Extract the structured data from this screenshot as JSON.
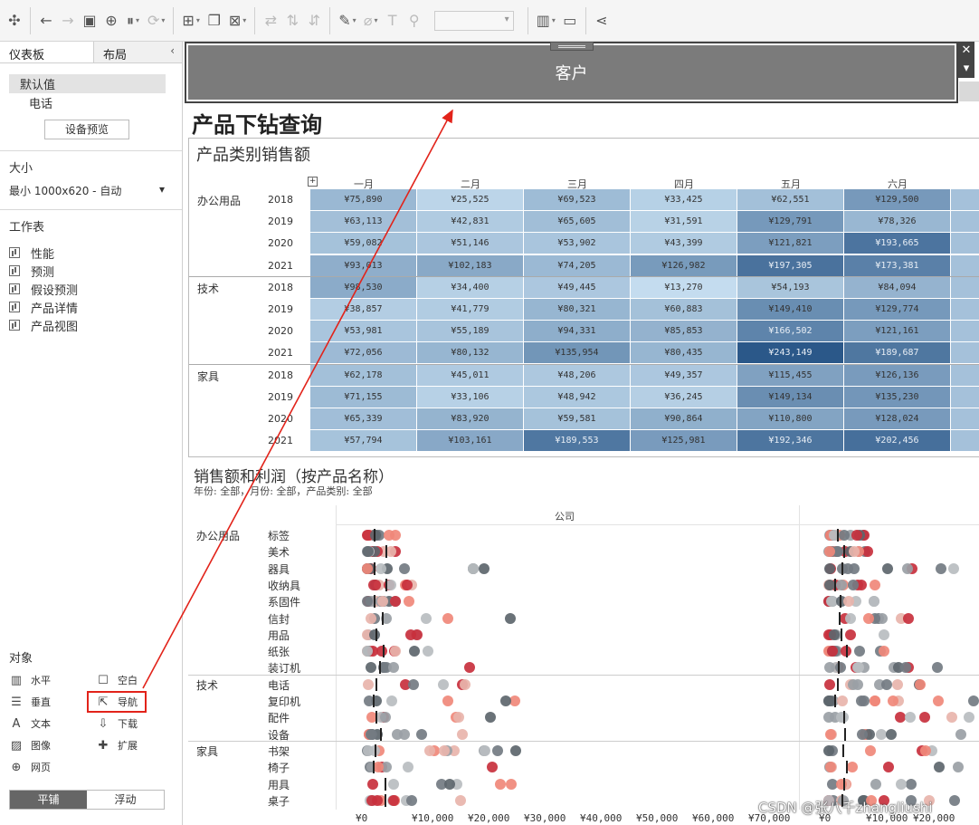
{
  "toolbar": {
    "items": [
      {
        "icon": "tableau-logo-icon"
      },
      {
        "icon": "undo-icon"
      },
      {
        "icon": "redo-icon"
      },
      {
        "icon": "save-icon"
      },
      {
        "icon": "new-datasource-icon"
      },
      {
        "icon": "pause-updates-icon"
      },
      {
        "icon": "refresh-icon"
      },
      {
        "icon": "new-worksheet-icon"
      },
      {
        "icon": "duplicate-icon"
      },
      {
        "icon": "clear-icon"
      },
      {
        "icon": "swap-icon"
      },
      {
        "icon": "sort-ascending-icon"
      },
      {
        "icon": "sort-descending-icon"
      },
      {
        "icon": "highlight-icon"
      },
      {
        "icon": "group-icon"
      },
      {
        "icon": "label-icon"
      },
      {
        "icon": "pin-icon"
      },
      {
        "icon": "show-me-icon"
      },
      {
        "icon": "presentation-icon"
      },
      {
        "icon": "share-icon"
      }
    ]
  },
  "left_panel": {
    "tab_dashboard": "仪表板",
    "tab_layout": "布局",
    "collapse": "‹",
    "device_default": "默认值",
    "device_phone": "电话",
    "device_preview": "设备预览",
    "size_title": "大小",
    "size_value": "最小 1000x620 - 自动",
    "worksheets_title": "工作表",
    "worksheets": [
      "性能",
      "预测",
      "假设预测",
      "产品详情",
      "产品视图"
    ],
    "objects_title": "对象",
    "objects": [
      {
        "label": "水平",
        "icon": "horizontal-container-icon"
      },
      {
        "label": "空白",
        "icon": "blank-icon"
      },
      {
        "label": "垂直",
        "icon": "vertical-container-icon"
      },
      {
        "label": "导航",
        "icon": "navigation-icon"
      },
      {
        "label": "文本",
        "icon": "text-icon"
      },
      {
        "label": "下载",
        "icon": "download-icon"
      },
      {
        "label": "图像",
        "icon": "image-icon"
      },
      {
        "label": "扩展",
        "icon": "extension-icon"
      },
      {
        "label": "网页",
        "icon": "web-page-icon"
      }
    ],
    "tiled": "平铺",
    "floating": "浮动"
  },
  "dashboard": {
    "filter_title": "客户",
    "title": "产品下钻查询",
    "heatmap": {
      "title": "产品类别销售额",
      "months": [
        "一月",
        "二月",
        "三月",
        "四月",
        "五月",
        "六月"
      ],
      "categories": [
        "办公用品",
        "技术",
        "家具"
      ],
      "years": [
        "2018",
        "2019",
        "2020",
        "2021"
      ],
      "values": [
        [
          [
            "¥75,890",
            "¥25,525",
            "¥69,523",
            "¥33,425",
            "¥62,551",
            "¥129,500"
          ],
          [
            "¥63,113",
            "¥42,831",
            "¥65,605",
            "¥31,591",
            "¥129,791",
            "¥78,326"
          ],
          [
            "¥59,082",
            "¥51,146",
            "¥53,902",
            "¥43,399",
            "¥121,821",
            "¥193,665"
          ],
          [
            "¥93,013",
            "¥102,183",
            "¥74,205",
            "¥126,982",
            "¥197,305",
            "¥173,381"
          ]
        ],
        [
          [
            "¥98,530",
            "¥34,400",
            "¥49,445",
            "¥13,270",
            "¥54,193",
            "¥84,094"
          ],
          [
            "¥38,857",
            "¥41,779",
            "¥80,321",
            "¥60,883",
            "¥149,410",
            "¥129,774"
          ],
          [
            "¥53,981",
            "¥55,189",
            "¥94,331",
            "¥85,853",
            "¥166,502",
            "¥121,161"
          ],
          [
            "¥72,056",
            "¥80,132",
            "¥135,954",
            "¥80,435",
            "¥243,149",
            "¥189,687"
          ]
        ],
        [
          [
            "¥62,178",
            "¥45,011",
            "¥48,206",
            "¥49,357",
            "¥115,455",
            "¥126,136"
          ],
          [
            "¥71,155",
            "¥33,106",
            "¥48,942",
            "¥36,245",
            "¥149,134",
            "¥135,230"
          ],
          [
            "¥65,339",
            "¥83,920",
            "¥59,581",
            "¥90,864",
            "¥110,800",
            "¥128,024"
          ],
          [
            "¥57,794",
            "¥103,161",
            "¥189,553",
            "¥125,981",
            "¥192,346",
            "¥202,456"
          ]
        ]
      ]
    },
    "scatter": {
      "title": "销售额和利润（按产品名称）",
      "subtitle": "年份: 全部，月份: 全部，产品类别: 全部",
      "column_header": "公司",
      "groups": [
        {
          "category": "办公用品",
          "products": [
            "标签",
            "美术",
            "器具",
            "收纳具",
            "系固件",
            "信封",
            "用品",
            "纸张",
            "装订机"
          ]
        },
        {
          "category": "技术",
          "products": [
            "电话",
            "复印机",
            "配件",
            "设备"
          ]
        },
        {
          "category": "家具",
          "products": [
            "书架",
            "椅子",
            "用具",
            "桌子"
          ]
        }
      ],
      "x_ticks": [
        "¥0",
        "¥10,000",
        "¥20,000",
        "¥30,000",
        "¥40,000",
        "¥50,000",
        "¥60,000",
        "¥70,000"
      ],
      "x_ticks_2": [
        "¥0",
        "¥10,000",
        "¥20,000"
      ]
    }
  },
  "watermark": "CSDN @张八千zhangliushi",
  "colors": {
    "annotation": "#e2231a",
    "heat_low": "#c6def0",
    "heat_high": "#2a5b8c",
    "dot_grey": "#737b82",
    "dot_red": "#c8303d",
    "dot_salmon": "#f0887a"
  }
}
